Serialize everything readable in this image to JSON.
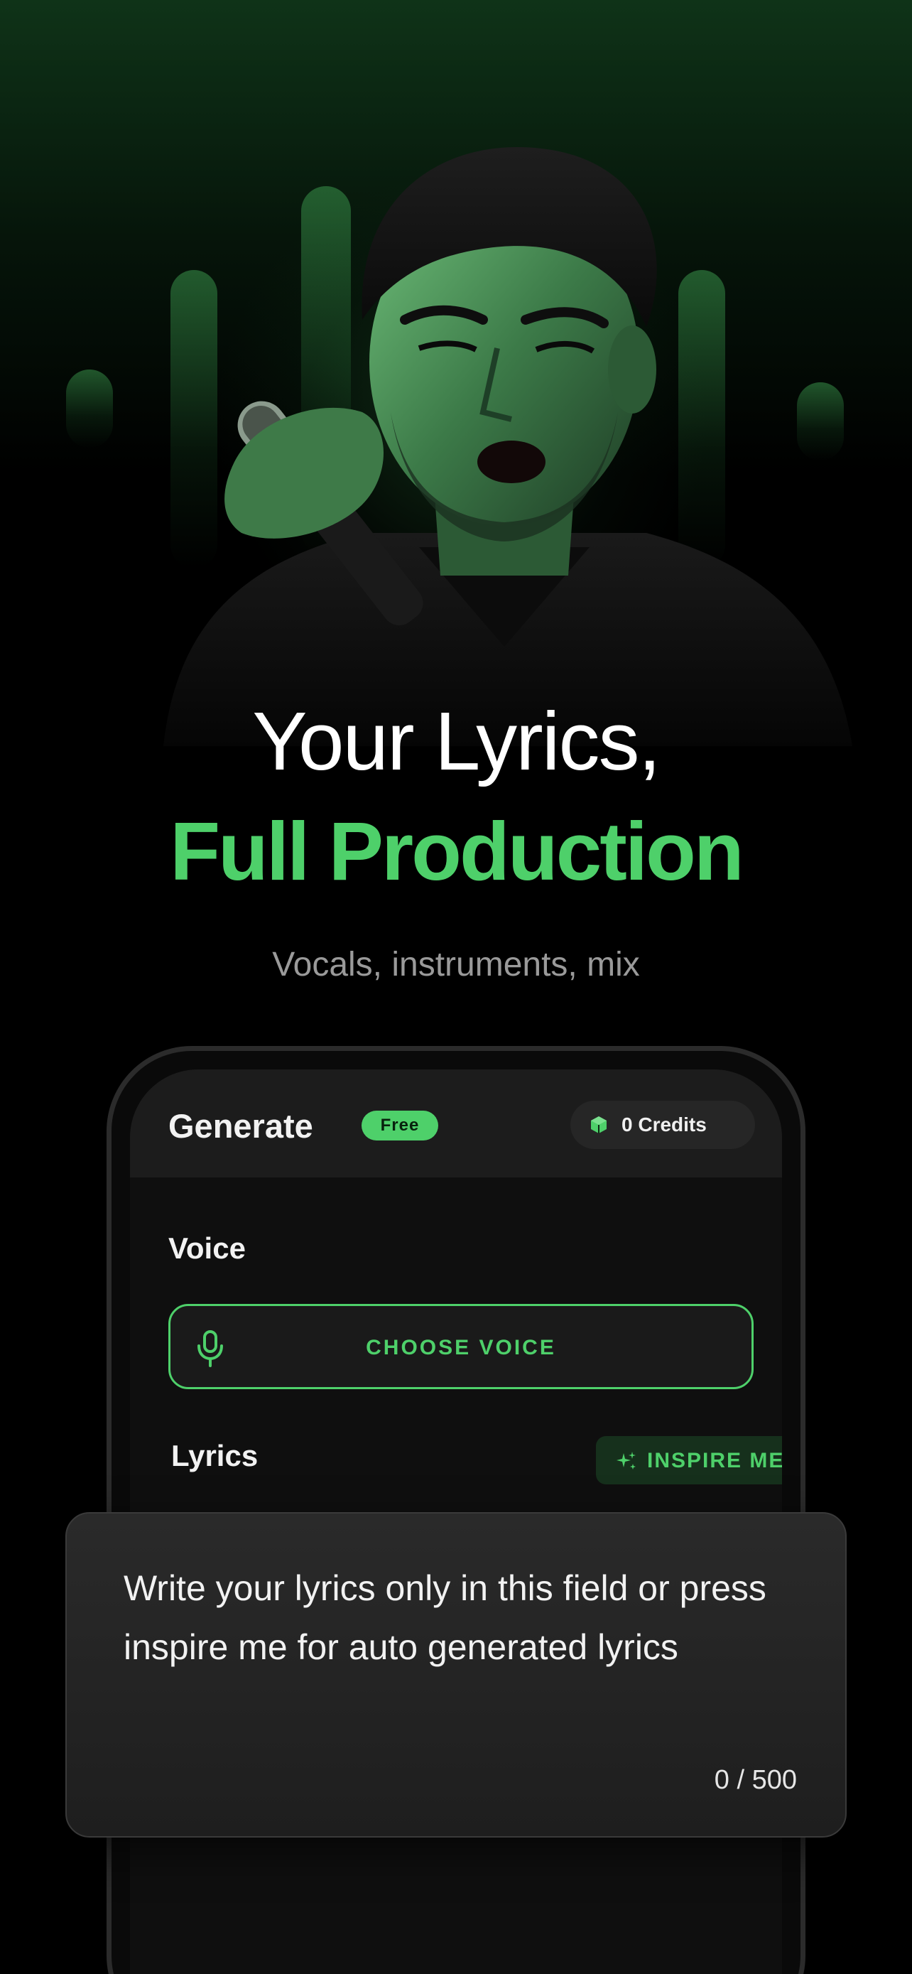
{
  "hero": {
    "headline_line1": "Your Lyrics,",
    "headline_line2": "Full Production",
    "subhead": "Vocals, instruments, mix",
    "accent_color": "#4ed06a"
  },
  "app": {
    "header": {
      "title": "Generate",
      "badge": "Free",
      "credits": "0 Credits",
      "credits_icon": "cube-icon"
    },
    "voice": {
      "label": "Voice",
      "button_label": "CHOOSE VOICE",
      "button_icon": "microphone-icon"
    },
    "lyrics": {
      "label": "Lyrics",
      "inspire_label": "INSPIRE ME",
      "inspire_icon": "sparkle-icon",
      "placeholder": "Write your lyrics only in this field or press inspire me for auto generated lyrics",
      "char_count": "0 / 500"
    }
  }
}
